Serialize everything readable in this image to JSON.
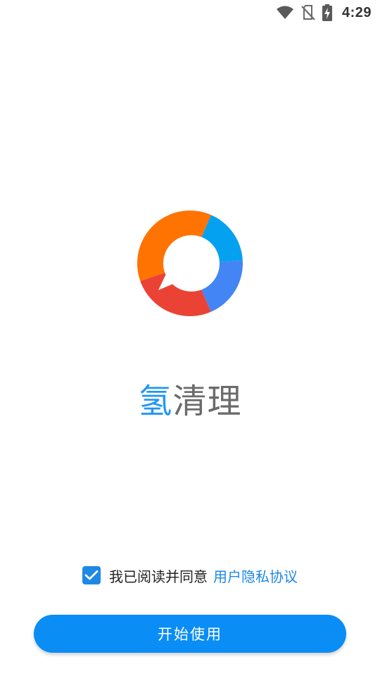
{
  "status_bar": {
    "time": "4:29",
    "icons": [
      "wifi-icon",
      "no-sim-icon",
      "battery-charging-icon"
    ]
  },
  "logo": {
    "icon": "chat-ring-logo-icon",
    "colors": {
      "orange": "#ff7300",
      "cyan": "#03a1ef",
      "blue": "#4485f5",
      "red": "#ea4335"
    }
  },
  "app_name": {
    "accent_char": "氢",
    "rest": "清理",
    "accent_color": "#2196f3",
    "text_color": "#6b6b6b"
  },
  "agreement": {
    "checked": true,
    "text": "我已阅读并同意",
    "link_text": "用户隐私协议",
    "link_color": "#1e88e5"
  },
  "start_button": {
    "label": "开始使用",
    "color": "#0a8df5"
  }
}
